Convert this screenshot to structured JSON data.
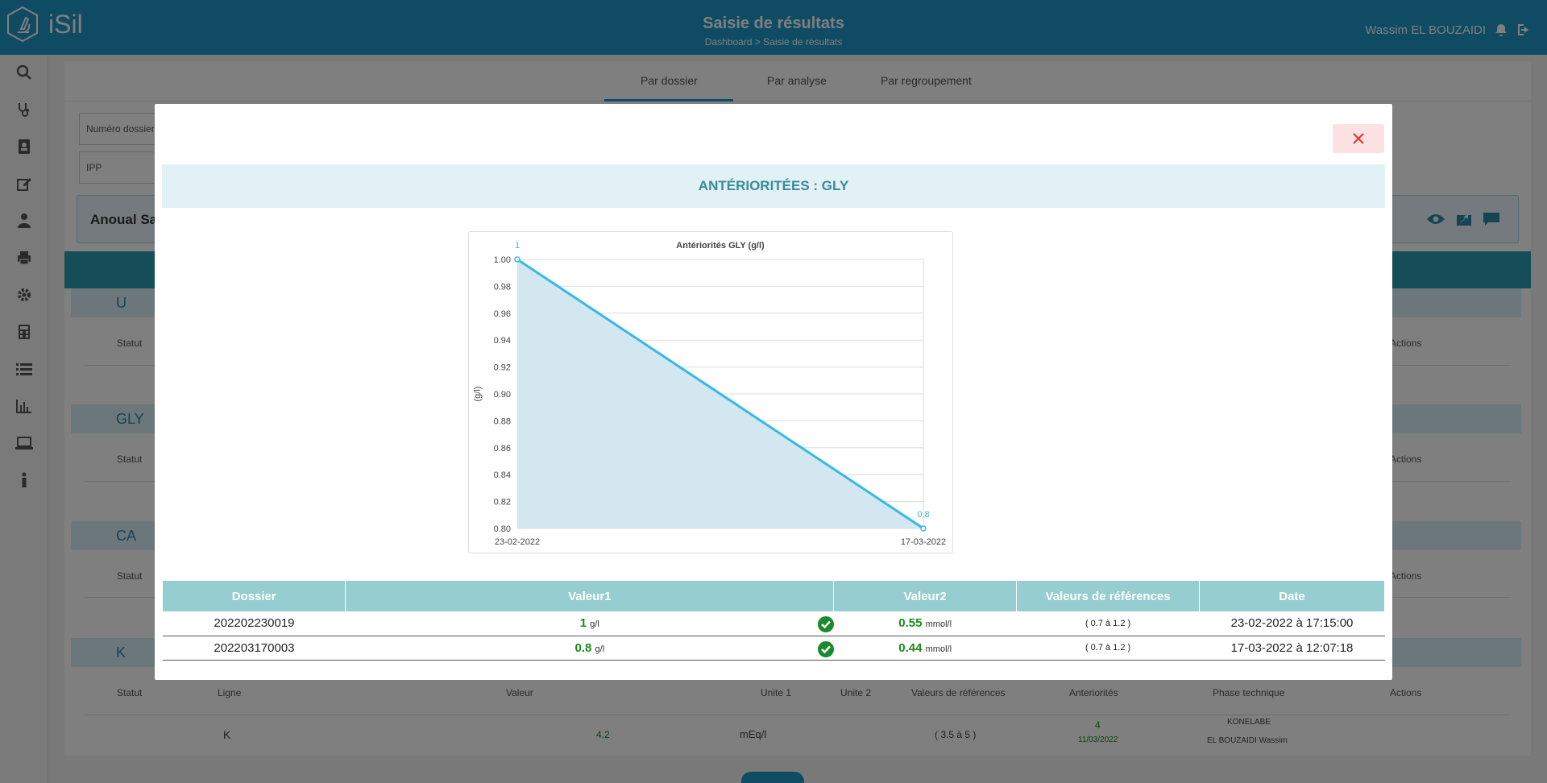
{
  "app": {
    "logo_text": "iSil",
    "page_title": "Saisie de résultats",
    "breadcrumb": "Dashboard > Saisie de résultats",
    "user_name": "Wassim EL BOUZAIDI"
  },
  "tabs": [
    {
      "label": "Par dossier",
      "active": true
    },
    {
      "label": "Par analyse",
      "active": false
    },
    {
      "label": "Par regroupement",
      "active": false
    }
  ],
  "filters": {
    "dossier_placeholder": "Numéro dossier",
    "ipp_placeholder": "IPP"
  },
  "patient": {
    "name_partial": "Anoual Sa"
  },
  "groups": [
    {
      "code": "U"
    },
    {
      "code": "GLY"
    },
    {
      "code": "CA"
    },
    {
      "code": "K"
    }
  ],
  "row_headers": {
    "statut": "Statut",
    "ligne": "Ligne",
    "valeur": "Valeur",
    "unite1": "Unite 1",
    "unite2": "Unite 2",
    "refs": "Valeurs de références",
    "anteriorites": "Anteriorités",
    "phase": "Phase technique",
    "actions": "Actions"
  },
  "k_row": {
    "ligne": "K",
    "valeur": "4.2",
    "unite1": "mEq/l",
    "refs": "( 3.5 à 5 )",
    "anteriorite_value": "4",
    "anteriorite_date": "11/03/2022",
    "phase_line1": "KONELABE",
    "phase_line2": "EL BOUZAIDI  Wassim"
  },
  "modal": {
    "title": "ANTÉRIORITÉES : GLY",
    "table": {
      "headers": [
        "Dossier",
        "Valeur1",
        "Valeur2",
        "Valeurs de références",
        "Date"
      ],
      "rows": [
        {
          "dossier": "202202230019",
          "v1": "1",
          "v1_unit": "g/l",
          "v2": "0.55",
          "v2_unit": "mmol/l",
          "refs": "( 0.7 à 1.2 )",
          "date": "23-02-2022 à 17:15:00"
        },
        {
          "dossier": "202203170003",
          "v1": "0.8",
          "v1_unit": "g/l",
          "v2": "0.44",
          "v2_unit": "mmol/l",
          "refs": "( 0.7 à 1.2 )",
          "date": "17-03-2022 à 12:07:18"
        }
      ]
    }
  },
  "chart_data": {
    "type": "area",
    "title": "Antériorités GLY (g/l)",
    "xlabel": "",
    "ylabel": "(g/l)",
    "categories": [
      "23-02-2022",
      "17-03-2022"
    ],
    "values": [
      1,
      0.8
    ],
    "data_labels": [
      "1",
      "0.8"
    ],
    "ylim": [
      0.8,
      1.0
    ],
    "yticks": [
      "1.00",
      "0.98",
      "0.96",
      "0.94",
      "0.92",
      "0.90",
      "0.88",
      "0.86",
      "0.84",
      "0.82",
      "0.80"
    ],
    "grid": true,
    "line_color": "#36b9e8",
    "fill_color": "#d3e7f0"
  }
}
